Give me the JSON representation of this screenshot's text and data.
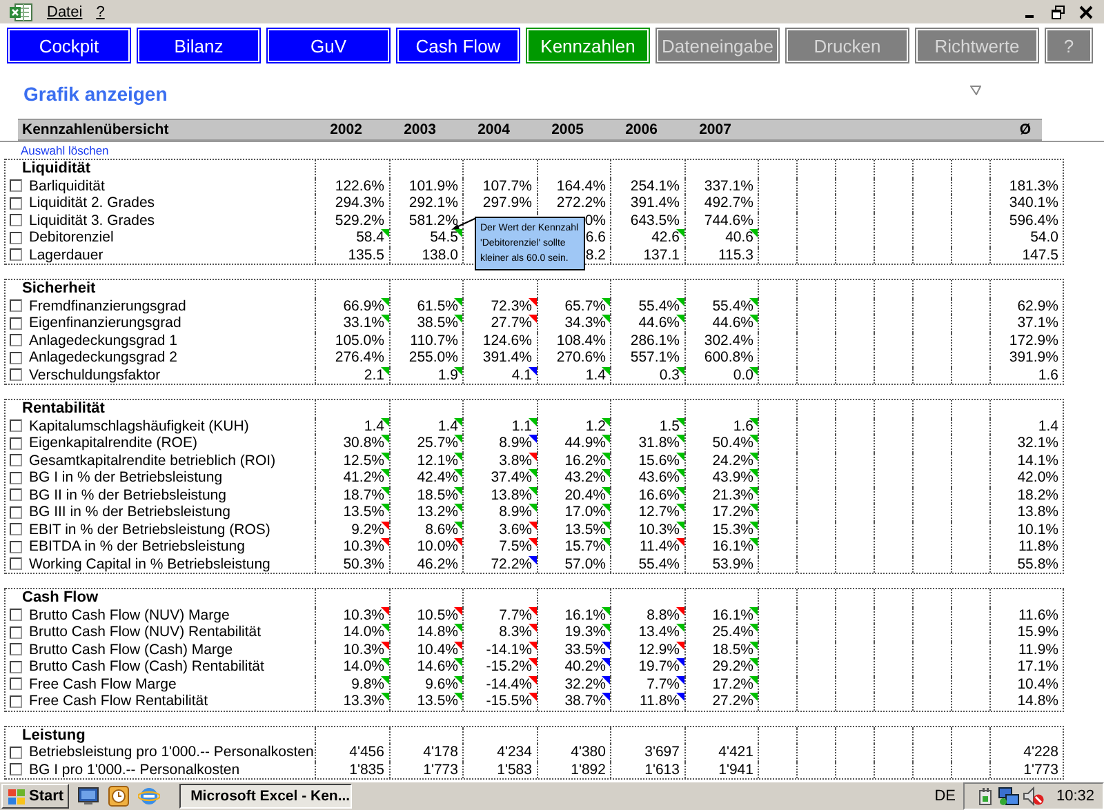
{
  "menu": [
    "Datei",
    "?"
  ],
  "nav": [
    {
      "label": "Cockpit",
      "color": "#0000ff",
      "disabled": false
    },
    {
      "label": "Bilanz",
      "color": "#0000ff",
      "disabled": false
    },
    {
      "label": "GuV",
      "color": "#0000ff",
      "disabled": false
    },
    {
      "label": "Cash Flow",
      "color": "#0000ff",
      "disabled": false
    },
    {
      "label": "Kennzahlen",
      "color": "#009900",
      "disabled": false
    },
    {
      "label": "Dateneingabe",
      "color": "#808080",
      "disabled": true
    },
    {
      "label": "Drucken",
      "color": "#808080",
      "disabled": true
    },
    {
      "label": "Richtwerte",
      "color": "#808080",
      "disabled": true
    },
    {
      "label": "?",
      "color": "#808080",
      "disabled": true
    }
  ],
  "title": "Grafik anzeigen",
  "overview": {
    "heading": "Kennzahlenübersicht",
    "years": [
      "2002",
      "2003",
      "2004",
      "2005",
      "2006",
      "2007"
    ],
    "avg_label": "Ø"
  },
  "clear_link": "Auswahl löschen",
  "sections": [
    {
      "title": "Liquidität",
      "rows": [
        {
          "label": "Barliquidität",
          "checked": false,
          "cells": [
            {
              "v": "122.6%"
            },
            {
              "v": "101.9%"
            },
            {
              "v": "107.7%"
            },
            {
              "v": "164.4%"
            },
            {
              "v": "254.1%"
            },
            {
              "v": "337.1%"
            }
          ],
          "avg": "181.3%"
        },
        {
          "label": "Liquidität 2. Grades",
          "checked": false,
          "cells": [
            {
              "v": "294.3%"
            },
            {
              "v": "292.1%"
            },
            {
              "v": "297.9%"
            },
            {
              "v": "272.2%"
            },
            {
              "v": "391.4%"
            },
            {
              "v": "492.7%"
            }
          ],
          "avg": "340.1%"
        },
        {
          "label": "Liquidität 3. Grades",
          "checked": false,
          "cells": [
            {
              "v": "529.2%"
            },
            {
              "v": "581.2%"
            },
            null,
            {
              "v": "0%"
            },
            {
              "v": "643.5%"
            },
            {
              "v": "744.6%"
            }
          ],
          "avg": "596.4%"
        },
        {
          "label": "Debitorenziel",
          "checked": false,
          "cells": [
            {
              "v": "58.4",
              "color": "#00c000"
            },
            {
              "v": "54.5",
              "color": "#00c000"
            },
            null,
            {
              "v": "6.6"
            },
            {
              "v": "42.6",
              "color": "#00c000"
            },
            {
              "v": "40.6",
              "color": "#00c000"
            }
          ],
          "avg": "54.0"
        },
        {
          "label": "Lagerdauer",
          "checked": false,
          "cells": [
            {
              "v": "135.5"
            },
            {
              "v": "138.0"
            },
            null,
            {
              "v": "8.2"
            },
            {
              "v": "137.1"
            },
            {
              "v": "115.3"
            }
          ],
          "avg": "147.5"
        }
      ]
    },
    {
      "title": "Sicherheit",
      "rows": [
        {
          "label": "Fremdfinanzierungsgrad",
          "checked": false,
          "cells": [
            {
              "v": "66.9%",
              "color": "#00c000"
            },
            {
              "v": "61.5%",
              "color": "#00c000"
            },
            {
              "v": "72.3%",
              "color": "#ff0000"
            },
            {
              "v": "65.7%",
              "color": "#00c000"
            },
            {
              "v": "55.4%",
              "color": "#00c000"
            },
            {
              "v": "55.4%",
              "color": "#00c000"
            }
          ],
          "avg": "62.9%"
        },
        {
          "label": "Eigenfinanzierungsgrad",
          "checked": false,
          "cells": [
            {
              "v": "33.1%",
              "color": "#00c000"
            },
            {
              "v": "38.5%",
              "color": "#00c000"
            },
            {
              "v": "27.7%",
              "color": "#ff0000"
            },
            {
              "v": "34.3%",
              "color": "#00c000"
            },
            {
              "v": "44.6%",
              "color": "#00c000"
            },
            {
              "v": "44.6%",
              "color": "#00c000"
            }
          ],
          "avg": "37.1%"
        },
        {
          "label": "Anlagedeckungsgrad 1",
          "checked": false,
          "cells": [
            {
              "v": "105.0%"
            },
            {
              "v": "110.7%"
            },
            {
              "v": "124.6%"
            },
            {
              "v": "108.4%"
            },
            {
              "v": "286.1%"
            },
            {
              "v": "302.4%"
            }
          ],
          "avg": "172.9%"
        },
        {
          "label": "Anlagedeckungsgrad 2",
          "checked": false,
          "cells": [
            {
              "v": "276.4%"
            },
            {
              "v": "255.0%"
            },
            {
              "v": "391.4%"
            },
            {
              "v": "270.6%"
            },
            {
              "v": "557.1%"
            },
            {
              "v": "600.8%"
            }
          ],
          "avg": "391.9%"
        },
        {
          "label": "Verschuldungsfaktor",
          "checked": false,
          "cells": [
            {
              "v": "2.1",
              "color": "#00c000"
            },
            {
              "v": "1.9",
              "color": "#00c000"
            },
            {
              "v": "4.1",
              "color": "#0000ff"
            },
            {
              "v": "1.4",
              "color": "#00c000"
            },
            {
              "v": "0.3",
              "color": "#00c000"
            },
            {
              "v": "0.0",
              "color": "#00c000"
            }
          ],
          "avg": "1.6"
        }
      ]
    },
    {
      "title": "Rentabilität",
      "rows": [
        {
          "label": "Kapitalumschlagshäufigkeit (KUH)",
          "checked": false,
          "cells": [
            {
              "v": "1.4",
              "color": "#00c000"
            },
            {
              "v": "1.4",
              "color": "#00c000"
            },
            {
              "v": "1.1",
              "color": "#00c000"
            },
            {
              "v": "1.2",
              "color": "#00c000"
            },
            {
              "v": "1.5",
              "color": "#00c000"
            },
            {
              "v": "1.6",
              "color": "#00c000"
            }
          ],
          "avg": "1.4"
        },
        {
          "label": "Eigenkapitalrendite (ROE)",
          "checked": false,
          "cells": [
            {
              "v": "30.8%",
              "color": "#00c000"
            },
            {
              "v": "25.7%",
              "color": "#00c000"
            },
            {
              "v": "8.9%",
              "color": "#0000ff"
            },
            {
              "v": "44.9%",
              "color": "#00c000"
            },
            {
              "v": "31.8%",
              "color": "#00c000"
            },
            {
              "v": "50.4%",
              "color": "#00c000"
            }
          ],
          "avg": "32.1%"
        },
        {
          "label": "Gesamtkapitalrendite betrieblich (ROI)",
          "checked": false,
          "cells": [
            {
              "v": "12.5%",
              "color": "#00c000"
            },
            {
              "v": "12.1%",
              "color": "#00c000"
            },
            {
              "v": "3.8%",
              "color": "#ff0000"
            },
            {
              "v": "16.2%",
              "color": "#00c000"
            },
            {
              "v": "15.6%",
              "color": "#00c000"
            },
            {
              "v": "24.2%",
              "color": "#00c000"
            }
          ],
          "avg": "14.1%"
        },
        {
          "label": "BG I in % der Betriebsleistung",
          "checked": false,
          "cells": [
            {
              "v": "41.2%",
              "color": "#00c000"
            },
            {
              "v": "42.4%",
              "color": "#00c000"
            },
            {
              "v": "37.4%",
              "color": "#00c000"
            },
            {
              "v": "43.2%",
              "color": "#00c000"
            },
            {
              "v": "43.6%",
              "color": "#00c000"
            },
            {
              "v": "43.9%",
              "color": "#00c000"
            }
          ],
          "avg": "42.0%"
        },
        {
          "label": "BG II in % der Betriebsleistung",
          "checked": false,
          "cells": [
            {
              "v": "18.7%",
              "color": "#00c000"
            },
            {
              "v": "18.5%",
              "color": "#00c000"
            },
            {
              "v": "13.8%",
              "color": "#00c000"
            },
            {
              "v": "20.4%",
              "color": "#00c000"
            },
            {
              "v": "16.6%",
              "color": "#00c000"
            },
            {
              "v": "21.3%",
              "color": "#00c000"
            }
          ],
          "avg": "18.2%"
        },
        {
          "label": "BG III in % der Betriebsleistung",
          "checked": false,
          "cells": [
            {
              "v": "13.5%",
              "color": "#00c000"
            },
            {
              "v": "13.2%",
              "color": "#00c000"
            },
            {
              "v": "8.9%",
              "color": "#00c000"
            },
            {
              "v": "17.0%",
              "color": "#00c000"
            },
            {
              "v": "12.7%",
              "color": "#00c000"
            },
            {
              "v": "17.2%",
              "color": "#00c000"
            }
          ],
          "avg": "13.8%"
        },
        {
          "label": "EBIT in % der Betriebsleistung (ROS)",
          "checked": false,
          "cells": [
            {
              "v": "9.2%",
              "color": "#ff0000"
            },
            {
              "v": "8.6%",
              "color": "#00c000"
            },
            {
              "v": "3.6%",
              "color": "#ff0000"
            },
            {
              "v": "13.5%",
              "color": "#00c000"
            },
            {
              "v": "10.3%",
              "color": "#00c000"
            },
            {
              "v": "15.3%",
              "color": "#00c000"
            }
          ],
          "avg": "10.1%"
        },
        {
          "label": "EBITDA in % der Betriebsleistung",
          "checked": false,
          "cells": [
            {
              "v": "10.3%",
              "color": "#ff0000"
            },
            {
              "v": "10.0%",
              "color": "#ff0000"
            },
            {
              "v": "7.5%",
              "color": "#ff0000"
            },
            {
              "v": "15.7%",
              "color": "#00c000"
            },
            {
              "v": "11.4%",
              "color": "#ff0000"
            },
            {
              "v": "16.1%",
              "color": "#00c000"
            }
          ],
          "avg": "11.8%"
        },
        {
          "label": "Working Capital in % Betriebsleistung",
          "checked": false,
          "cells": [
            {
              "v": "50.3%"
            },
            {
              "v": "46.2%"
            },
            {
              "v": "72.2%",
              "color": "#0000ff"
            },
            {
              "v": "57.0%"
            },
            {
              "v": "55.4%"
            },
            {
              "v": "53.9%"
            }
          ],
          "avg": "55.8%"
        }
      ]
    },
    {
      "title": "Cash Flow",
      "rows": [
        {
          "label": "Brutto Cash Flow (NUV) Marge",
          "checked": false,
          "cells": [
            {
              "v": "10.3%",
              "color": "#ff0000"
            },
            {
              "v": "10.5%",
              "color": "#ff0000"
            },
            {
              "v": "7.7%",
              "color": "#ff0000"
            },
            {
              "v": "16.1%",
              "color": "#00c000"
            },
            {
              "v": "8.8%",
              "color": "#ff0000"
            },
            {
              "v": "16.1%",
              "color": "#00c000"
            }
          ],
          "avg": "11.6%"
        },
        {
          "label": "Brutto Cash Flow (NUV) Rentabilität",
          "checked": false,
          "cells": [
            {
              "v": "14.0%",
              "color": "#00c000"
            },
            {
              "v": "14.8%",
              "color": "#00c000"
            },
            {
              "v": "8.3%",
              "color": "#ff0000"
            },
            {
              "v": "19.3%",
              "color": "#00c000"
            },
            {
              "v": "13.4%",
              "color": "#00c000"
            },
            {
              "v": "25.4%",
              "color": "#00c000"
            }
          ],
          "avg": "15.9%"
        },
        {
          "label": "Brutto Cash Flow (Cash) Marge",
          "checked": false,
          "cells": [
            {
              "v": "10.3%",
              "color": "#ff0000"
            },
            {
              "v": "10.4%",
              "color": "#ff0000"
            },
            {
              "v": "-14.1%",
              "color": "#ff0000"
            },
            {
              "v": "33.5%",
              "color": "#0000ff"
            },
            {
              "v": "12.9%",
              "color": "#ff0000"
            },
            {
              "v": "18.5%",
              "color": "#00c000"
            }
          ],
          "avg": "11.9%"
        },
        {
          "label": "Brutto Cash Flow (Cash) Rentabilität",
          "checked": false,
          "cells": [
            {
              "v": "14.0%",
              "color": "#00c000"
            },
            {
              "v": "14.6%",
              "color": "#00c000"
            },
            {
              "v": "-15.2%",
              "color": "#ff0000"
            },
            {
              "v": "40.2%",
              "color": "#0000ff"
            },
            {
              "v": "19.7%",
              "color": "#0000ff"
            },
            {
              "v": "29.2%",
              "color": "#00c000"
            }
          ],
          "avg": "17.1%"
        },
        {
          "label": "Free Cash Flow Marge",
          "checked": false,
          "cells": [
            {
              "v": "9.8%",
              "color": "#00c000"
            },
            {
              "v": "9.6%",
              "color": "#00c000"
            },
            {
              "v": "-14.4%",
              "color": "#ff0000"
            },
            {
              "v": "32.2%",
              "color": "#0000ff"
            },
            {
              "v": "7.7%",
              "color": "#0000ff"
            },
            {
              "v": "17.2%",
              "color": "#00c000"
            }
          ],
          "avg": "10.4%"
        },
        {
          "label": "Free Cash Flow Rentabilität",
          "checked": false,
          "cells": [
            {
              "v": "13.3%",
              "color": "#00c000"
            },
            {
              "v": "13.5%",
              "color": "#00c000"
            },
            {
              "v": "-15.5%",
              "color": "#ff0000"
            },
            {
              "v": "38.7%",
              "color": "#0000ff"
            },
            {
              "v": "11.8%",
              "color": "#0000ff"
            },
            {
              "v": "27.2%",
              "color": "#00c000"
            }
          ],
          "avg": "14.8%"
        }
      ]
    },
    {
      "title": "Leistung",
      "rows": [
        {
          "label": "Betriebsleistung pro 1'000.-- Personalkosten",
          "checked": false,
          "cells": [
            {
              "v": "4'456"
            },
            {
              "v": "4'178"
            },
            {
              "v": "4'234"
            },
            {
              "v": "4'380"
            },
            {
              "v": "3'697"
            },
            {
              "v": "4'421"
            }
          ],
          "avg": "4'228"
        },
        {
          "label": "BG I pro 1'000.-- Personalkosten",
          "checked": false,
          "cells": [
            {
              "v": "1'835"
            },
            {
              "v": "1'773"
            },
            {
              "v": "1'583"
            },
            {
              "v": "1'892"
            },
            {
              "v": "1'613"
            },
            {
              "v": "1'941"
            }
          ],
          "avg": "1'773"
        }
      ]
    }
  ],
  "tooltip": {
    "text": "Der Wert der Kennzahl 'Debitorenziel' sollte kleiner als 60.0 sein."
  },
  "taskbar": {
    "start": "Start",
    "task": "Microsoft Excel - Ken...",
    "language": "DE",
    "clock": "10:32"
  }
}
